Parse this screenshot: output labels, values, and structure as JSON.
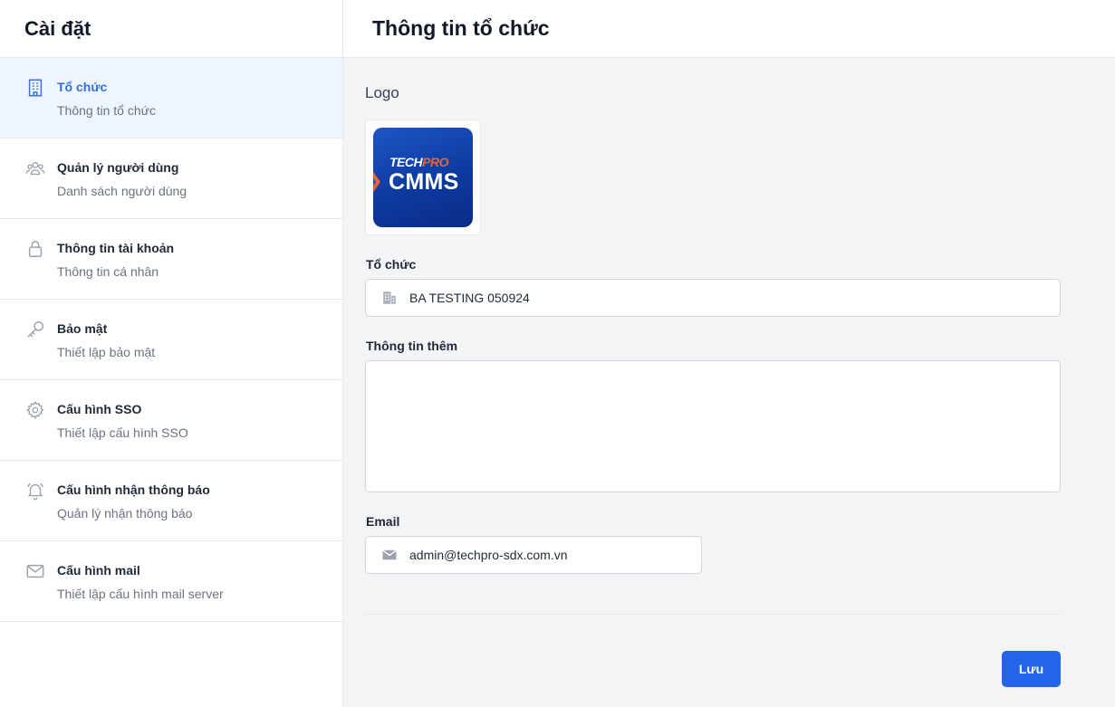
{
  "sidebar": {
    "title": "Cài đặt",
    "items": [
      {
        "label": "Tổ chức",
        "sub": "Thông tin tổ chức",
        "icon": "building-icon",
        "active": true
      },
      {
        "label": "Quản lý người dùng",
        "sub": "Danh sách người dùng",
        "icon": "users-icon"
      },
      {
        "label": "Thông tin tài khoản",
        "sub": "Thông tin cá nhân",
        "icon": "lock-icon"
      },
      {
        "label": "Bảo mật",
        "sub": "Thiết lập bảo mật",
        "icon": "key-icon"
      },
      {
        "label": "Cấu hình SSO",
        "sub": "Thiết lập cấu hình SSO",
        "icon": "gear-icon"
      },
      {
        "label": "Cấu hình nhận thông báo",
        "sub": "Quản lý nhận thông báo",
        "icon": "bell-icon"
      },
      {
        "label": "Cấu hình mail",
        "sub": "Thiết lập cấu hình mail server",
        "icon": "mail-icon"
      }
    ]
  },
  "header": {
    "title": "Thông tin tổ chức"
  },
  "form": {
    "logo_label": "Logo",
    "logo": {
      "tech": "TECH",
      "pro": "PRO",
      "product": "CMMS"
    },
    "org_label": "Tổ chức",
    "org_value": "BA TESTING 050924",
    "extra_label": "Thông tin thêm",
    "extra_value": "",
    "email_label": "Email",
    "email_value": "admin@techpro-sdx.com.vn",
    "save_label": "Lưu"
  },
  "colors": {
    "accent": "#2563eb",
    "active_bg": "#eff5ff",
    "logo_blue": "#0d3aa0",
    "logo_orange": "#e8642c"
  }
}
